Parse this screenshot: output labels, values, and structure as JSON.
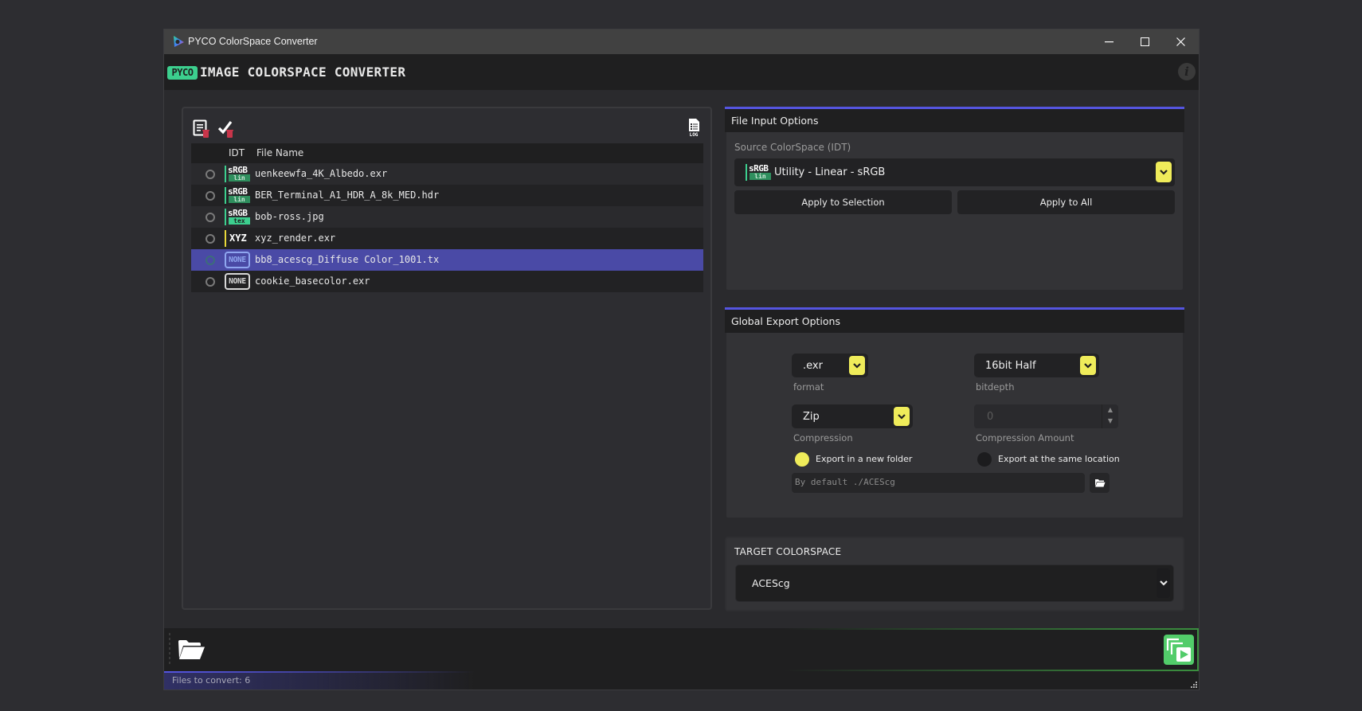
{
  "window": {
    "title": "PYCO ColorSpace Converter",
    "controls": {
      "minimize": "—",
      "maximize": "☐",
      "close": "✕"
    }
  },
  "header": {
    "logo_badge": "PYCO",
    "title": "IMAGE COLORSPACE CONVERTER",
    "info_icon": "i"
  },
  "file_list": {
    "toolbar": {
      "clear_all": "clear-list-icon",
      "clear_selected": "clear-selected-icon",
      "log": "log-icon"
    },
    "columns": {
      "idt": "IDT",
      "file_name": "File Name"
    },
    "rows": [
      {
        "idt_type": "srgb",
        "idt_top": "sRGB",
        "idt_sub": "lin",
        "file_name": "uenkeewfa_4K_Albedo.exr",
        "selected": false
      },
      {
        "idt_type": "srgb",
        "idt_top": "sRGB",
        "idt_sub": "lin",
        "file_name": "BER_Terminal_A1_HDR_A_8k_MED.hdr",
        "selected": false
      },
      {
        "idt_type": "srgb",
        "idt_top": "sRGB",
        "idt_sub": "tex",
        "file_name": "bob-ross.jpg",
        "selected": false
      },
      {
        "idt_type": "xyz",
        "idt_top": "XYZ",
        "idt_sub": "",
        "file_name": "xyz_render.exr",
        "selected": false
      },
      {
        "idt_type": "none",
        "idt_top": "NONE",
        "idt_sub": "",
        "file_name": "bb8_acescg_Diffuse Color_1001.tx",
        "selected": true
      },
      {
        "idt_type": "none",
        "idt_top": "NONE",
        "idt_sub": "",
        "file_name": "cookie_basecolor.exr",
        "selected": false
      }
    ]
  },
  "file_input_options": {
    "title": "File Input Options",
    "source_label": "Source ColorSpace (IDT)",
    "source_badge_top": "sRGB",
    "source_badge_sub": "lin",
    "source_value": "Utility - Linear - sRGB",
    "apply_selection": "Apply to Selection",
    "apply_all": "Apply to All"
  },
  "global_export_options": {
    "title": "Global Export Options",
    "format_value": ".exr",
    "format_label": "format",
    "bitdepth_value": "16bit Half",
    "bitdepth_label": "bitdepth",
    "compression_value": "Zip",
    "compression_label": "Compression",
    "compression_amount_value": "0",
    "compression_amount_label": "Compression Amount",
    "export_new_folder": "Export in a new folder",
    "export_same_location": "Export at the same location",
    "export_mode_selected": "new_folder",
    "path_placeholder": "By default ./ACEScg"
  },
  "target_colorspace": {
    "title": "TARGET COLORSPACE",
    "value": "ACEScg"
  },
  "status": {
    "text": "Files to convert: 6"
  },
  "colors": {
    "accent_blue": "#5555e0",
    "accent_yellow": "#efec5a",
    "accent_green": "#3ccf8e",
    "run_green": "#52cc6a",
    "selection": "#4a4aa6"
  }
}
